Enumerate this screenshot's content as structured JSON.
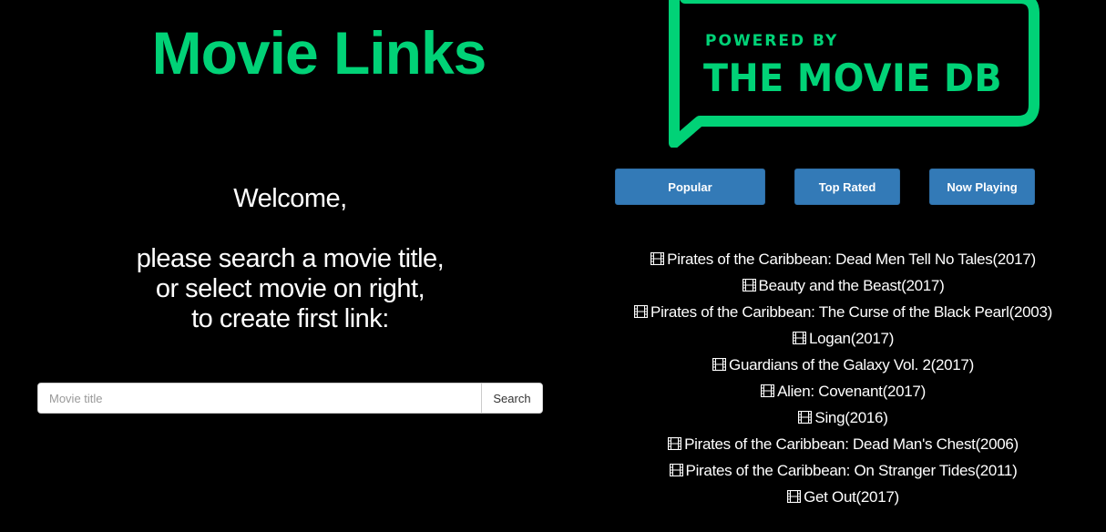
{
  "header": {
    "title": "Movie Links"
  },
  "welcome": {
    "greeting": "Welcome,",
    "line1": "please search a movie title,",
    "line2": "or select movie on right,",
    "line3": "to create first link:"
  },
  "search": {
    "placeholder": "Movie title",
    "value": "",
    "button_label": "Search"
  },
  "logo": {
    "line1": "POWERED BY",
    "line2": "THE MOVIE DB"
  },
  "nav": {
    "popular": "Popular",
    "top_rated": "Top Rated",
    "now_playing": "Now Playing"
  },
  "movies": [
    {
      "title": "Pirates of the Caribbean: Dead Men Tell No Tales(2017)"
    },
    {
      "title": "Beauty and the Beast(2017)"
    },
    {
      "title": "Pirates of the Caribbean: The Curse of the Black Pearl(2003)"
    },
    {
      "title": "Logan(2017)"
    },
    {
      "title": "Guardians of the Galaxy Vol. 2(2017)"
    },
    {
      "title": "Alien: Covenant(2017)"
    },
    {
      "title": "Sing(2016)"
    },
    {
      "title": "Pirates of the Caribbean: Dead Man's Chest(2006)"
    },
    {
      "title": "Pirates of the Caribbean: On Stranger Tides(2011)"
    },
    {
      "title": "Get Out(2017)"
    }
  ],
  "icons": {
    "movie_item": "film-icon"
  },
  "colors": {
    "accent": "#01d277",
    "button": "#337ab7",
    "background": "#000000",
    "text": "#ffffff"
  }
}
